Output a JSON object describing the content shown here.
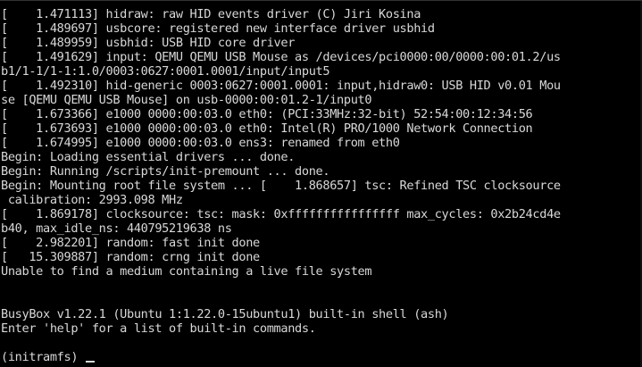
{
  "terminal": {
    "lines": [
      "[    1.471113] hidraw: raw HID events driver (C) Jiri Kosina",
      "[    1.489697] usbcore: registered new interface driver usbhid",
      "[    1.489959] usbhid: USB HID core driver",
      "[    1.491629] input: QEMU QEMU USB Mouse as /devices/pci0000:00/0000:00:01.2/us",
      "b1/1-1/1-1:1.0/0003:0627:0001.0001/input/input5",
      "[    1.492310] hid-generic 0003:0627:0001.0001: input,hidraw0: USB HID v0.01 Mou",
      "se [QEMU QEMU USB Mouse] on usb-0000:00:01.2-1/input0",
      "[    1.673366] e1000 0000:00:03.0 eth0: (PCI:33MHz:32-bit) 52:54:00:12:34:56",
      "[    1.673693] e1000 0000:00:03.0 eth0: Intel(R) PRO/1000 Network Connection",
      "[    1.674995] e1000 0000:00:03.0 ens3: renamed from eth0",
      "Begin: Loading essential drivers ... done.",
      "Begin: Running /scripts/init-premount ... done.",
      "Begin: Mounting root file system ... [    1.868657] tsc: Refined TSC clocksource",
      " calibration: 2993.098 MHz",
      "[    1.869178] clocksource: tsc: mask: 0xffffffffffffffff max_cycles: 0x2b24cd4e",
      "b40, max_idle_ns: 440795219638 ns",
      "[    2.982201] random: fast init done",
      "[   15.309887] random: crng init done",
      "Unable to find a medium containing a live file system",
      "",
      "",
      "BusyBox v1.22.1 (Ubuntu 1:1.22.0-15ubuntu1) built-in shell (ash)",
      "Enter 'help' for a list of built-in commands.",
      ""
    ],
    "prompt": "(initramfs) "
  },
  "colors": {
    "background": "#000000",
    "text": "#d8d8d8"
  }
}
